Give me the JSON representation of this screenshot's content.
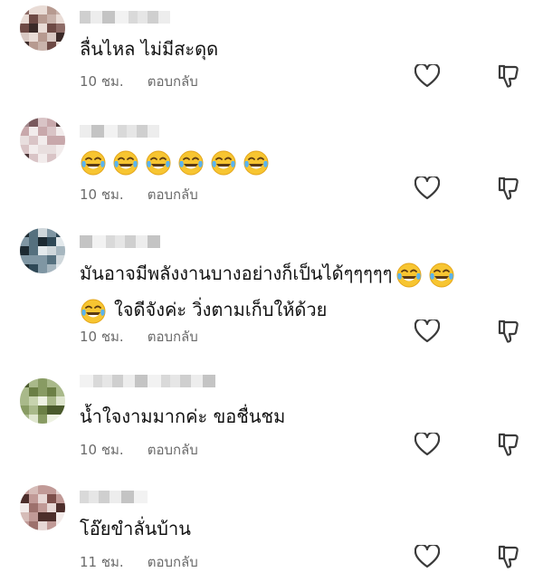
{
  "comments": [
    {
      "text_lines": [
        "ลื่นไหล ไม่มีสะดุด"
      ],
      "emoji_count": 0,
      "time": "10 ชม.",
      "reply_label": "ตอบกลับ"
    },
    {
      "text_lines": [
        ""
      ],
      "emoji_count": 6,
      "time": "10 ชม.",
      "reply_label": "ตอบกลับ"
    },
    {
      "text_lines": [
        "มันอาจมีพลังงานบางอย่างก็เป็นได้ๆๆๆๆๆ",
        "ใจดีจังค่ะ วิ่งตามเก็บให้ด้วย"
      ],
      "emoji_count": 3,
      "time": "10 ชม.",
      "reply_label": "ตอบกลับ"
    },
    {
      "text_lines": [
        "น้ำใจงามมากค่ะ ขอชื่นชม"
      ],
      "emoji_count": 0,
      "time": "10 ชม.",
      "reply_label": "ตอบกลับ"
    },
    {
      "text_lines": [
        "โอ๊ยขำลั่นบ้าน"
      ],
      "emoji_count": 0,
      "time": "11 ชม.",
      "reply_label": "ตอบกลับ"
    }
  ],
  "icons": {
    "like": "heart-icon",
    "dislike": "thumbs-down-icon",
    "emoji": "tears-of-joy-emoji"
  },
  "colors": {
    "text": "#111111",
    "meta": "#6b6b6b",
    "emoji_face": "#F7C531"
  }
}
